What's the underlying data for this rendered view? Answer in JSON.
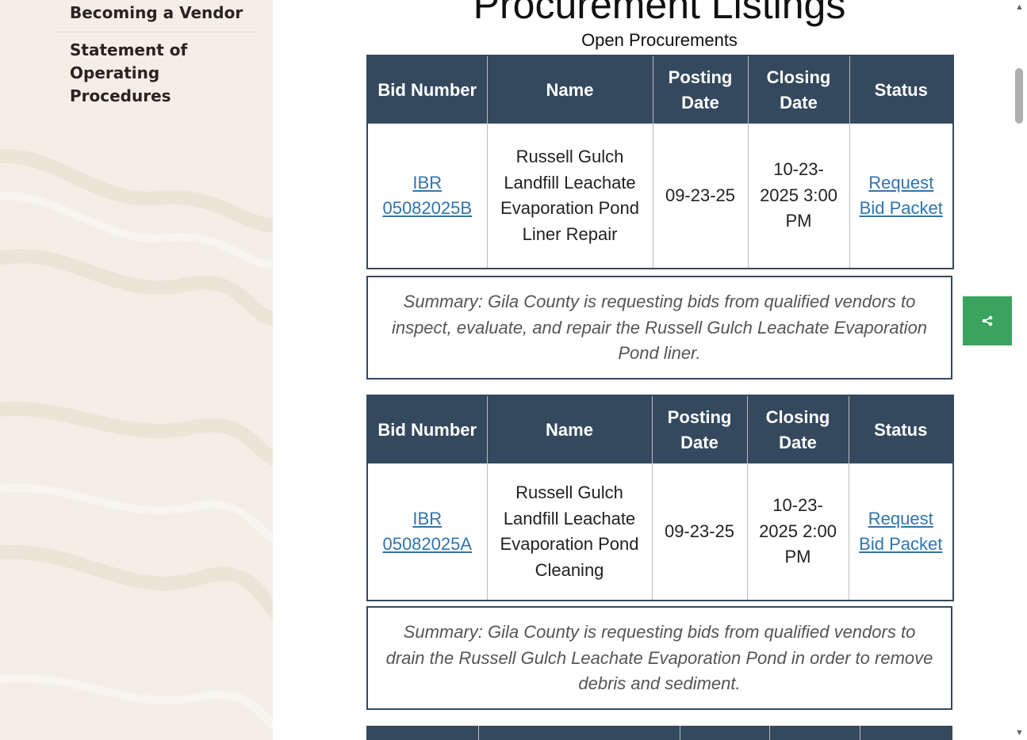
{
  "sidebar": {
    "items": [
      {
        "label": "Becoming a Vendor"
      },
      {
        "label": "Statement of Operating Procedures"
      }
    ]
  },
  "main": {
    "title": "Procurement Listings",
    "caption": "Open Procurements",
    "headers": [
      "Bid Number",
      "Name",
      "Posting Date",
      "Closing Date",
      "Status"
    ],
    "bids": [
      {
        "bid_number": "IBR 05082025B",
        "name": "Russell Gulch Landfill Leachate Evaporation Pond Liner Repair",
        "posting_date": "09-23-25",
        "closing_date": "10-23-2025 3:00 PM",
        "status": "Request Bid Packet",
        "summary": "Summary: Gila County is requesting bids from qualified vendors to inspect, evaluate, and repair the Russell Gulch Leachate Evaporation Pond liner."
      },
      {
        "bid_number": "IBR 05082025A",
        "name": "Russell Gulch Landfill Leachate Evaporation Pond Cleaning",
        "posting_date": "09-23-25",
        "closing_date": "10-23-2025 2:00 PM",
        "status": "Request Bid Packet",
        "summary": "Summary: Gila County is requesting bids from qualified vendors to drain the Russell Gulch Leachate Evaporation Pond in order to remove debris and sediment."
      }
    ]
  },
  "share": {
    "icon": "share-icon"
  },
  "colors": {
    "header_bg": "#34495e",
    "link": "#2e75b0",
    "share_bg": "#3aa45e",
    "sidebar_bg": "#f3efe6"
  }
}
